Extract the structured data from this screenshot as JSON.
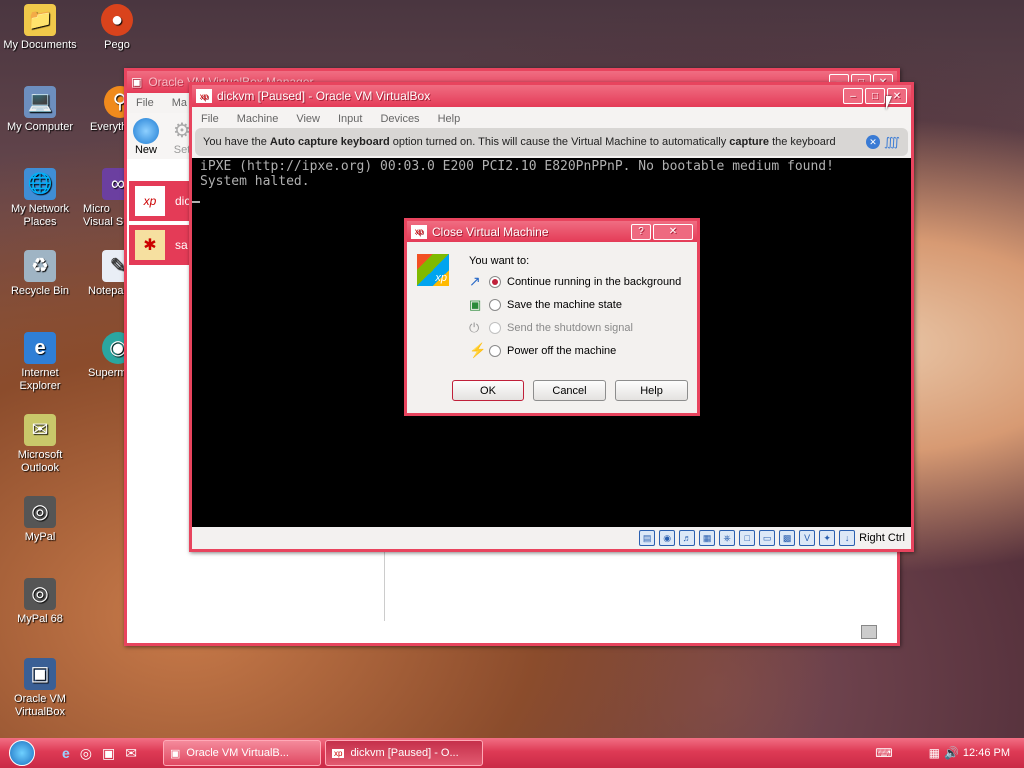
{
  "desktop": {
    "icons_left": [
      {
        "label": "My Documents",
        "icon": "folder-icon"
      },
      {
        "label": "My Computer",
        "icon": "computer-icon"
      },
      {
        "label": "My Network Places",
        "icon": "network-icon"
      },
      {
        "label": "Recycle Bin",
        "icon": "recycle-bin-icon"
      },
      {
        "label": "Internet Explorer",
        "icon": "internet-explorer-icon"
      },
      {
        "label": "Microsoft Outlook",
        "icon": "outlook-icon"
      },
      {
        "label": "MyPal",
        "icon": "mypal-icon"
      },
      {
        "label": "MyPal 68",
        "icon": "mypal68-icon"
      },
      {
        "label": "Oracle VM VirtualBox",
        "icon": "virtualbox-icon"
      }
    ],
    "icons_second": [
      {
        "label": "Pego",
        "icon": "pego-icon"
      },
      {
        "label": "Everyth",
        "icon": "everything-icon"
      },
      {
        "label": "Micro Visual S",
        "icon": "visual-studio-icon"
      },
      {
        "label": "Notepa",
        "icon": "notepad-icon"
      },
      {
        "label": "Superm",
        "icon": "supermium-icon"
      }
    ]
  },
  "manager_window": {
    "title": "Oracle VM VirtualBox Manager",
    "menu": [
      "File",
      "Ma"
    ],
    "toolbar": {
      "new": "New",
      "settings": "Set"
    },
    "vms": [
      {
        "name": "dic",
        "icon": "xp-vm-icon"
      },
      {
        "name": "sa",
        "icon": "saved-vm-icon"
      }
    ]
  },
  "vm_window": {
    "title": "dickvm [Paused] - Oracle VM VirtualBox",
    "menu": [
      "File",
      "Machine",
      "View",
      "Input",
      "Devices",
      "Help"
    ],
    "infobar": {
      "prefix": "You have the ",
      "bold1": "Auto capture keyboard",
      "middle": " option turned on. This will cause the Virtual Machine to automatically ",
      "bold2": "capture",
      "suffix": " the keyboard"
    },
    "console_lines": [
      "iPXE (http://ipxe.org) 00:03.0 E200 PCI2.10 E820PnPPnP. No bootable medium found!",
      "System halted."
    ],
    "host_key": "Right Ctrl"
  },
  "dialog": {
    "title": "Close Virtual Machine",
    "prompt": "You want to:",
    "options": [
      {
        "label": "Continue running in the background",
        "selected": true,
        "enabled": true
      },
      {
        "label": "Save the machine state",
        "selected": false,
        "enabled": true
      },
      {
        "label": "Send the shutdown signal",
        "selected": false,
        "enabled": false
      },
      {
        "label": "Power off the machine",
        "selected": false,
        "enabled": true
      }
    ],
    "buttons": {
      "ok": "OK",
      "cancel": "Cancel",
      "help": "Help"
    }
  },
  "taskbar": {
    "tasks": [
      {
        "label": "Oracle VM VirtualB...",
        "active": false
      },
      {
        "label": "dickvm [Paused] - O...",
        "active": true
      }
    ],
    "clock": "12:46 PM"
  }
}
